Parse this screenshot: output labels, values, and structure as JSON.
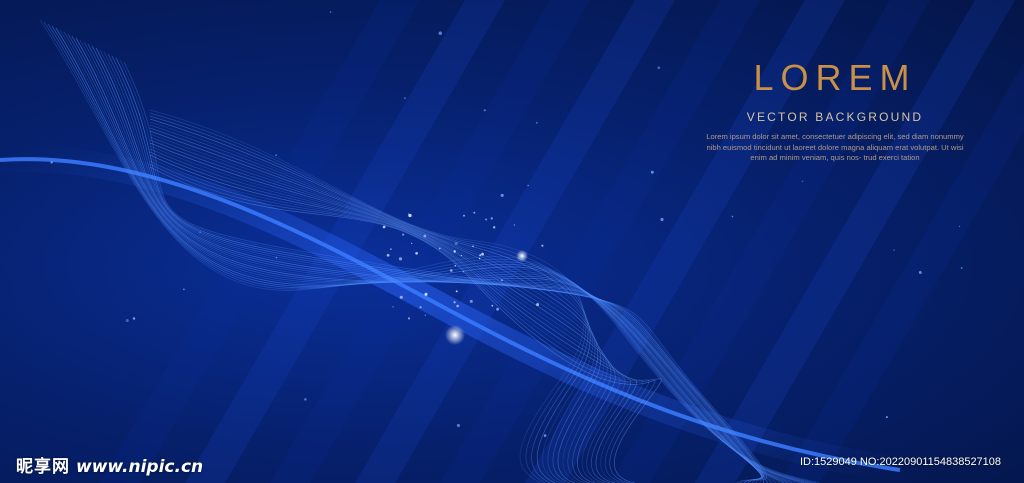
{
  "artwork": {
    "title": "LOREM",
    "subtitle": "VECTOR BACKGROUND",
    "body": "Lorem ipsum dolor sit amet, consectetuer adipiscing elit, sed diam nonummy nibh euismod tincidunt ut laoreet dolore magna aliquam erat volutpat. Ut wisi enim ad minim veniam, quis nos- trud exerci tation",
    "colors": {
      "background": "#06216f",
      "wave": "#4f8dff",
      "glow": "#1f5bff",
      "title": "#c9904a",
      "subtitle": "#d7c3a4"
    }
  },
  "watermark": {
    "logo_cn": "昵享网",
    "logo_url": "www.nipic.cn",
    "id_text": "ID:1529049 NO:20220901154838527108"
  }
}
